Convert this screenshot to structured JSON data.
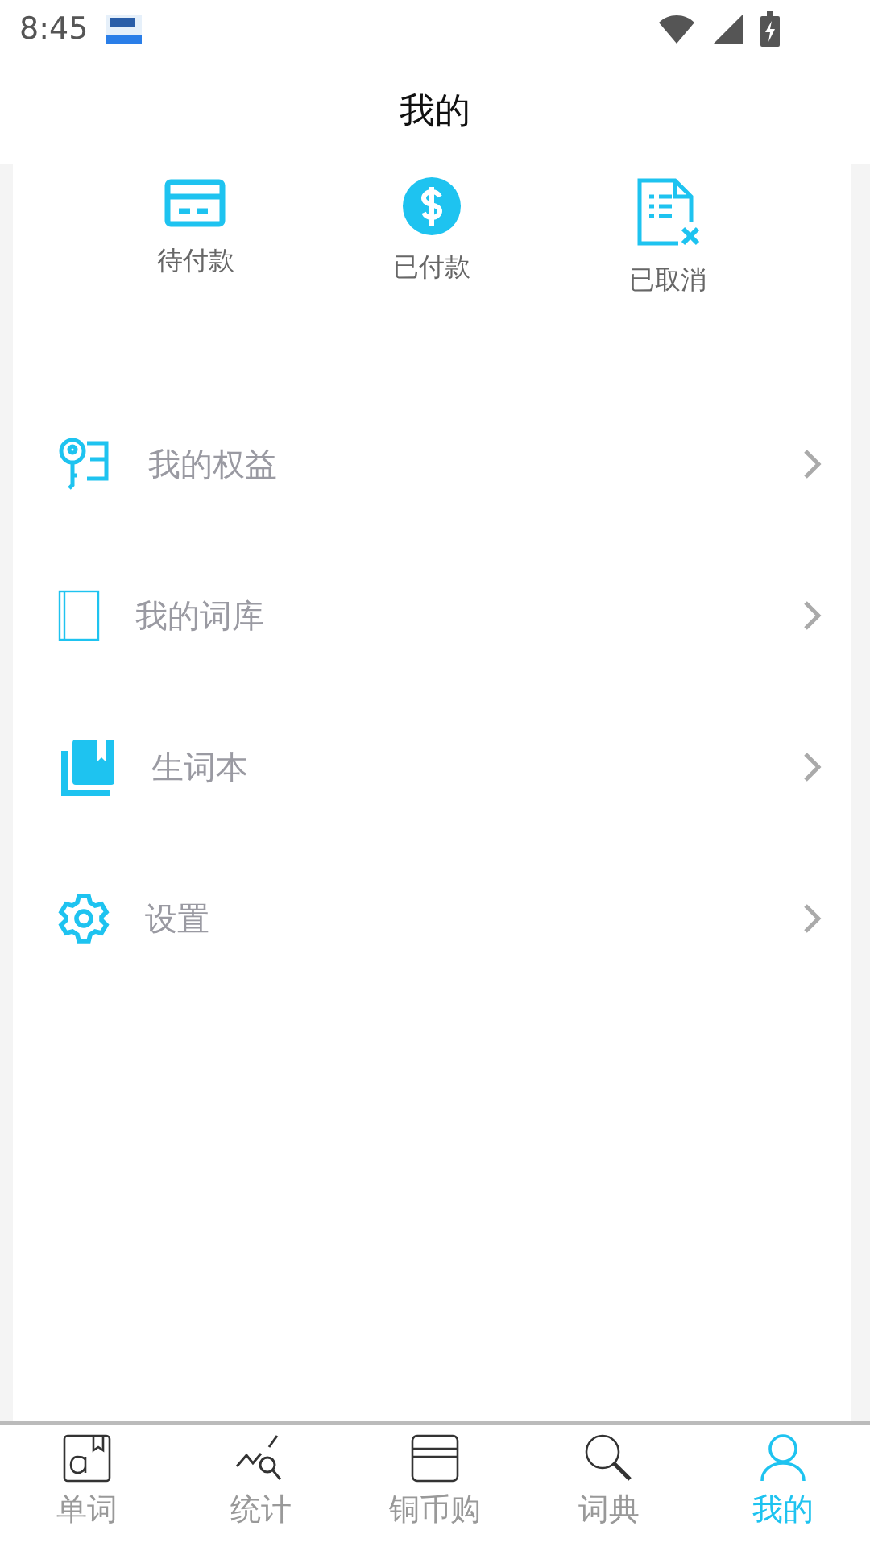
{
  "status_bar": {
    "time": "8:45"
  },
  "header": {
    "title": "我的"
  },
  "orders": [
    {
      "kind": "card",
      "label": "待付款"
    },
    {
      "kind": "dollar",
      "label": "已付款"
    },
    {
      "kind": "cancel",
      "label": "已取消"
    }
  ],
  "menu": [
    {
      "kind": "key",
      "label": "我的权益"
    },
    {
      "kind": "book",
      "label": "我的词库"
    },
    {
      "kind": "notebook",
      "label": "生词本"
    },
    {
      "kind": "gear",
      "label": "设置"
    }
  ],
  "tabs": [
    {
      "kind": "word",
      "label": "单词",
      "selected": false
    },
    {
      "kind": "stats",
      "label": "统计",
      "selected": false
    },
    {
      "kind": "shop",
      "label": "铜币购",
      "selected": false
    },
    {
      "kind": "dict",
      "label": "词典",
      "selected": false
    },
    {
      "kind": "user",
      "label": "我的",
      "selected": true
    }
  ]
}
